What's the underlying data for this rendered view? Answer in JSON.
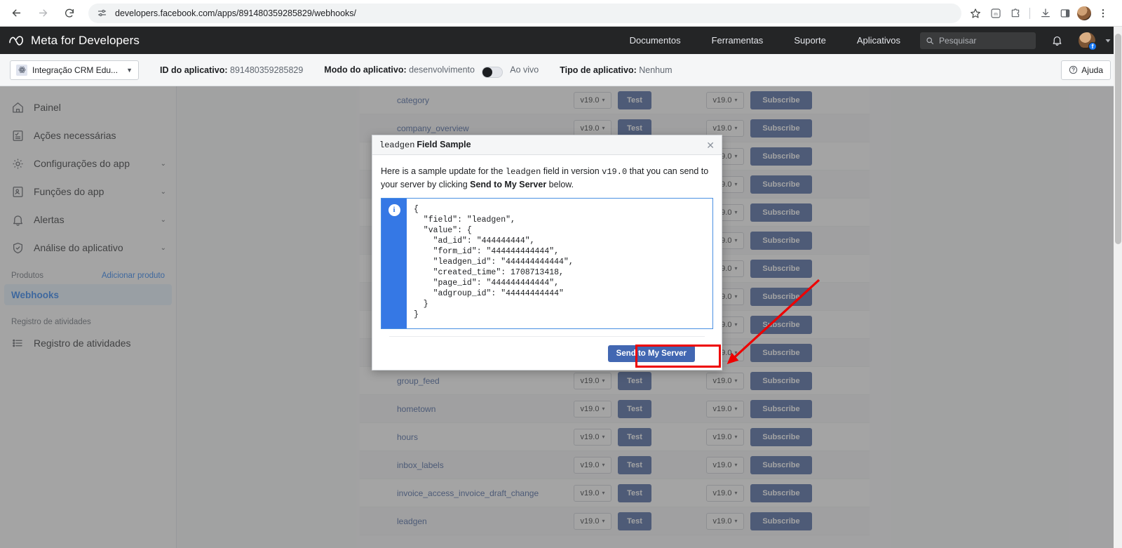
{
  "browser": {
    "url": "developers.facebook.com/apps/891480359285829/webhooks/",
    "back_icon": "back-arrow-icon",
    "forward_icon": "forward-arrow-icon",
    "reload_icon": "reload-icon",
    "site_settings_icon": "site-settings-icon",
    "star_icon": "bookmark-star-icon",
    "extensions": [
      "m-extension-icon",
      "puzzle-extension-icon"
    ],
    "download_icon": "download-icon",
    "side_panel_icon": "side-panel-icon",
    "profile_icon": "profile-avatar-icon",
    "menu_icon": "three-dot-menu-icon"
  },
  "meta_bar": {
    "brand": "Meta for Developers",
    "nav": [
      {
        "label": "Documentos"
      },
      {
        "label": "Ferramentas"
      },
      {
        "label": "Suporte"
      },
      {
        "label": "Aplicativos"
      }
    ],
    "search_placeholder": "Pesquisar",
    "search_icon": "search-icon",
    "bell_icon": "notification-bell-icon",
    "caret_icon": "chevron-down-icon"
  },
  "app_bar": {
    "app_selector": "Integração CRM Edu...",
    "app_selector_caret": "▼",
    "app_id_label": "ID do aplicativo:",
    "app_id_value": "891480359285829",
    "app_mode_label": "Modo do aplicativo:",
    "app_mode_value": "desenvolvimento",
    "live_label": "Ao vivo",
    "app_type_label": "Tipo de aplicativo:",
    "app_type_value": "Nenhum",
    "help_label": "Ajuda",
    "help_icon": "question-circle-icon"
  },
  "sidebar": {
    "items": [
      {
        "label": "Painel",
        "icon": "home-icon",
        "caret": false
      },
      {
        "label": "Ações necessárias",
        "icon": "checklist-icon",
        "caret": false
      },
      {
        "label": "Configurações do app",
        "icon": "gear-icon",
        "caret": true
      },
      {
        "label": "Funções do app",
        "icon": "id-card-icon",
        "caret": true
      },
      {
        "label": "Alertas",
        "icon": "bell-icon",
        "caret": true
      },
      {
        "label": "Análise do aplicativo",
        "icon": "shield-check-icon",
        "caret": true
      }
    ],
    "products_title": "Produtos",
    "add_product": "Adicionar produto",
    "webhooks": "Webhooks",
    "activity_section": "Registro de atividades",
    "activity_item": "Registro de atividades",
    "activity_icon": "list-icon",
    "caret_glyph": "⌄"
  },
  "table": {
    "version_value": "v19.0",
    "version_caret": "▾",
    "test_label": "Test",
    "subscribe_label": "Subscribe",
    "rows": [
      {
        "field": "category",
        "alt": false
      },
      {
        "field": "company_overview",
        "alt": true
      },
      {
        "field": "",
        "alt": false
      },
      {
        "field": "",
        "alt": true
      },
      {
        "field": "",
        "alt": false
      },
      {
        "field": "",
        "alt": true
      },
      {
        "field": "",
        "alt": false
      },
      {
        "field": "",
        "alt": true
      },
      {
        "field": "",
        "alt": false
      },
      {
        "field": "",
        "alt": true
      },
      {
        "field": "group_feed",
        "alt": false
      },
      {
        "field": "hometown",
        "alt": true
      },
      {
        "field": "hours",
        "alt": false
      },
      {
        "field": "inbox_labels",
        "alt": true
      },
      {
        "field": "invoice_access_invoice_draft_change",
        "alt": false
      },
      {
        "field": "leadgen",
        "alt": true
      }
    ]
  },
  "modal": {
    "title_field": "leadgen",
    "title_rest": "Field Sample",
    "close_glyph": "✕",
    "desc_part1": "Here is a sample update for the ",
    "desc_field": "leadgen",
    "desc_part2": " field in version ",
    "desc_version": "v19.0",
    "desc_part3": " that you can send to your server by clicking ",
    "desc_bold": "Send to My Server",
    "desc_part4": " below.",
    "info_glyph": "i",
    "sample_json": "{\n  \"field\": \"leadgen\",\n  \"value\": {\n    \"ad_id\": \"444444444\",\n    \"form_id\": \"444444444444\",\n    \"leadgen_id\": \"444444444444\",\n    \"created_time\": 1708713418,\n    \"page_id\": \"444444444444\",\n    \"adgroup_id\": \"44444444444\"\n  }\n}",
    "send_button": "Send to My Server"
  },
  "colors": {
    "accent_blue": "#1877f2",
    "fb_button_blue": "#3b5998",
    "send_button_blue": "#4267b2",
    "highlight_red": "#ee0000",
    "meta_dark": "#242526",
    "code_stripe": "#3578e5"
  }
}
